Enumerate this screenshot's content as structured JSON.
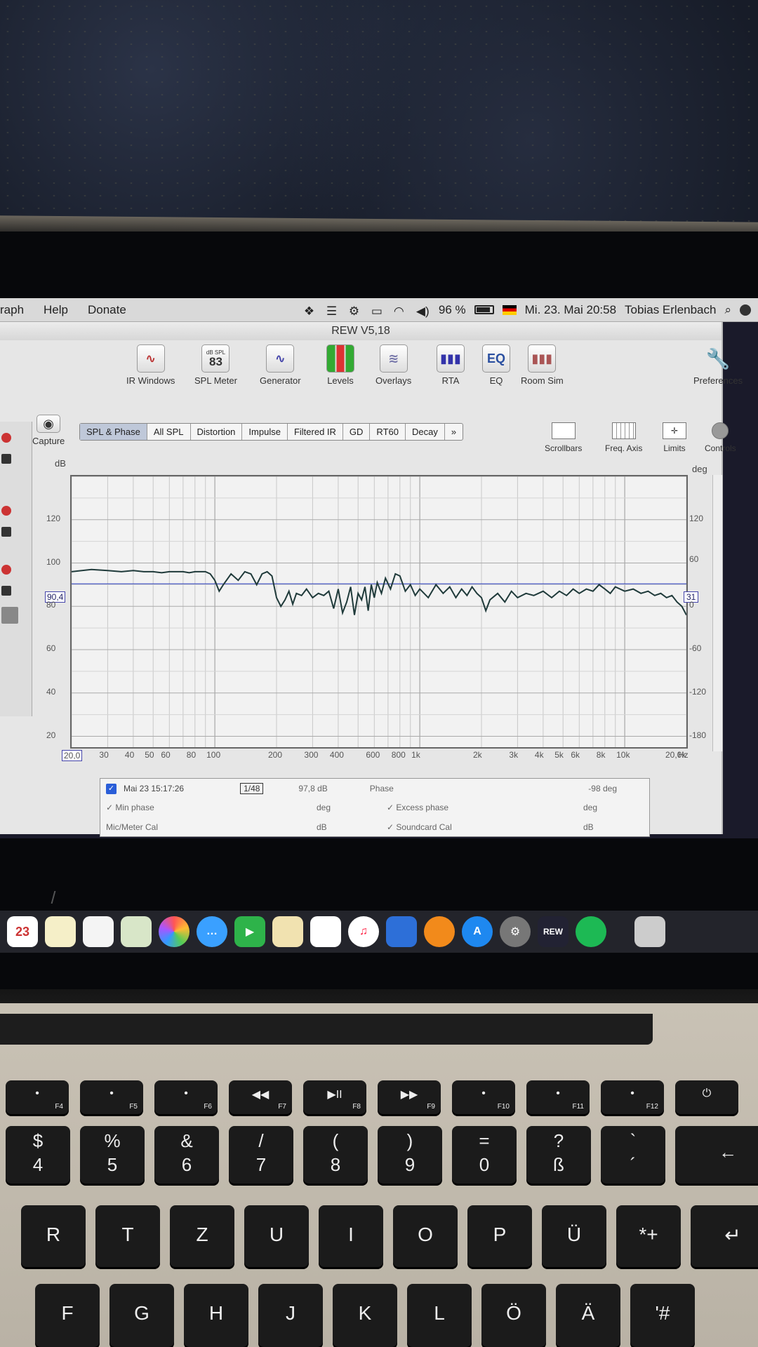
{
  "menubar": {
    "items": [
      "raph",
      "Help",
      "Donate"
    ],
    "battery": "96 %",
    "datetime": "Mi. 23. Mai  20:58",
    "user": "Tobias Erlenbach"
  },
  "window": {
    "title": "REW V5,18",
    "toolbar": [
      {
        "label": "IR Windows",
        "icon": "ir-windows-icon"
      },
      {
        "label": "SPL Meter",
        "icon": "spl-meter-icon",
        "badge_top": "dB SPL",
        "badge_value": "83"
      },
      {
        "label": "Generator",
        "icon": "generator-icon"
      },
      {
        "label": "Levels",
        "icon": "levels-icon"
      },
      {
        "label": "Overlays",
        "icon": "overlays-icon"
      },
      {
        "label": "RTA",
        "icon": "rta-icon"
      },
      {
        "label": "EQ",
        "icon": "eq-icon",
        "badge_value": "EQ"
      },
      {
        "label": "Room Sim",
        "icon": "room-sim-icon"
      },
      {
        "label": "Preferences",
        "icon": "wrench-icon"
      }
    ],
    "capture_label": "Capture",
    "tabs": [
      "SPL & Phase",
      "All SPL",
      "Distortion",
      "Impulse",
      "Filtered IR",
      "GD",
      "RT60",
      "Decay",
      "»"
    ],
    "active_tab": "SPL & Phase",
    "right_controls": [
      "Scrollbars",
      "Freq. Axis",
      "Limits",
      "Controls"
    ]
  },
  "chart_data": {
    "type": "line",
    "title": "",
    "left_unit": "dB",
    "right_unit": "deg",
    "y_ticks": [
      "120",
      "100",
      "80",
      "60",
      "40",
      "20"
    ],
    "y2_ticks": [
      "120",
      "60",
      "0",
      "-60",
      "-120",
      "-180"
    ],
    "x_ticks": [
      "20,0",
      "30",
      "40",
      "50",
      "60",
      "80",
      "100",
      "200",
      "300",
      "400",
      "600",
      "800",
      "1k",
      "2k",
      "3k",
      "4k",
      "5k",
      "6k",
      "8k",
      "10k",
      "20,0k",
      "Hz"
    ],
    "ylim": [
      15,
      140
    ],
    "xlim": [
      20,
      20000
    ],
    "x_scale": "log",
    "grid": true,
    "cursor_left": "90,4",
    "cursor_right": "31",
    "cursor_level": 90.4,
    "series": [
      {
        "name": "Mai 23 15:17:26",
        "color": "#1f3a3a",
        "x": [
          20,
          25,
          30,
          35,
          40,
          45,
          50,
          55,
          60,
          65,
          70,
          75,
          80,
          85,
          90,
          95,
          100,
          105,
          110,
          120,
          130,
          140,
          150,
          160,
          170,
          180,
          190,
          200,
          210,
          220,
          230,
          240,
          250,
          265,
          280,
          300,
          320,
          340,
          360,
          380,
          400,
          420,
          440,
          460,
          480,
          500,
          520,
          540,
          560,
          580,
          600,
          620,
          650,
          680,
          720,
          760,
          800,
          850,
          900,
          950,
          1000,
          1100,
          1200,
          1300,
          1400,
          1500,
          1600,
          1700,
          1800,
          1900,
          2000,
          2100,
          2200,
          2400,
          2600,
          2800,
          3000,
          3300,
          3600,
          4000,
          4400,
          4800,
          5200,
          5600,
          6000,
          6500,
          7000,
          7500,
          8000,
          8500,
          9000,
          10000,
          11000,
          12000,
          13000,
          14000,
          15000,
          16000,
          17000,
          18000,
          19000,
          20000
        ],
        "y": [
          96,
          97,
          96.5,
          96,
          96.5,
          96,
          96,
          95.5,
          96,
          96,
          96,
          95.5,
          96,
          96,
          96,
          95,
          92,
          87,
          90,
          95,
          92,
          96,
          95,
          90,
          95,
          96,
          94,
          84,
          80,
          83,
          87,
          81,
          86,
          85,
          88,
          84,
          86,
          85,
          87,
          79,
          88,
          77,
          82,
          89,
          76,
          86,
          83,
          89,
          78,
          90,
          84,
          91,
          86,
          93,
          88,
          95,
          94,
          87,
          90,
          85,
          88,
          84,
          90,
          86,
          89,
          84,
          88,
          85,
          89,
          86,
          84,
          78,
          83,
          86,
          82,
          87,
          84,
          86,
          85,
          87,
          84,
          87,
          85,
          88,
          86,
          88,
          87,
          90,
          88,
          86,
          89,
          87,
          88,
          86,
          87,
          85,
          86,
          84,
          85,
          82,
          80,
          76
        ]
      }
    ]
  },
  "legend": {
    "measurement": "Mai 23 15:17:26",
    "smoothing": "1/48",
    "level": "97,8 dB",
    "phase_label": "Phase",
    "phase_value": "-98 deg",
    "min_phase": "Min phase",
    "min_phase_unit": "deg",
    "excess_phase": "Excess phase",
    "excess_phase_unit": "deg",
    "mic_cal": "Mic/Meter Cal",
    "mic_cal_unit": "dB",
    "soundcard_cal": "Soundcard Cal",
    "soundcard_cal_unit": "dB"
  },
  "dock": {
    "calendar_day": "23",
    "rew_label": "REW"
  },
  "keyboard": {
    "fn_row": [
      {
        "fn": "F4",
        "icon": "launchpad-icon"
      },
      {
        "fn": "F5",
        "icon": "keyboard-light-down-icon"
      },
      {
        "fn": "F6",
        "icon": "keyboard-light-up-icon"
      },
      {
        "fn": "F7",
        "icon": "rewind-icon",
        "glyph": "◀◀"
      },
      {
        "fn": "F8",
        "icon": "play-pause-icon",
        "glyph": "▶II"
      },
      {
        "fn": "F9",
        "icon": "fast-forward-icon",
        "glyph": "▶▶"
      },
      {
        "fn": "F10",
        "icon": "mute-icon"
      },
      {
        "fn": "F11",
        "icon": "volume-down-icon"
      },
      {
        "fn": "F12",
        "icon": "volume-up-icon"
      },
      {
        "fn": "",
        "icon": "power-icon",
        "glyph": "⏻"
      }
    ],
    "number_row": [
      {
        "top": "$",
        "bottom": "4"
      },
      {
        "top": "%",
        "bottom": "5"
      },
      {
        "top": "&",
        "bottom": "6"
      },
      {
        "top": "/",
        "bottom": "7"
      },
      {
        "top": "(",
        "bottom": "8"
      },
      {
        "top": ")",
        "bottom": "9"
      },
      {
        "top": "=",
        "bottom": "0"
      },
      {
        "top": "?",
        "bottom": "ß"
      },
      {
        "top": "`",
        "bottom": "´"
      },
      {
        "top": "",
        "bottom": "←"
      }
    ],
    "qwertz_row": [
      "R",
      "T",
      "Z",
      "U",
      "I",
      "O",
      "P",
      "Ü",
      "*+",
      "↵"
    ],
    "home_row": [
      "F",
      "G",
      "H",
      "J",
      "K",
      "L",
      "Ö",
      "Ä",
      "'#"
    ]
  }
}
